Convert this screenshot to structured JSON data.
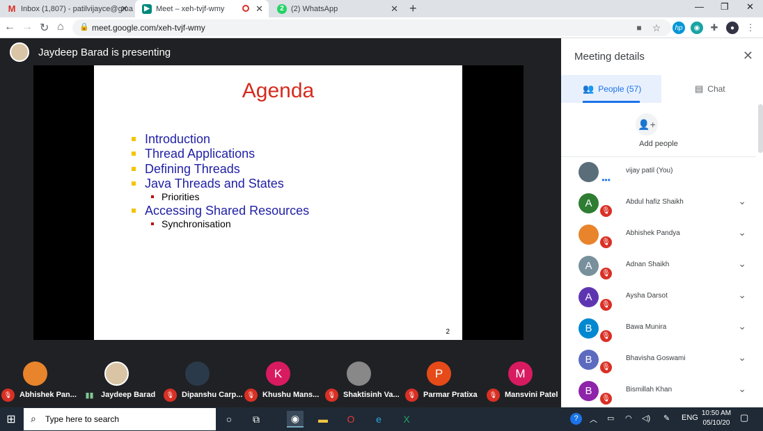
{
  "browser": {
    "tabs": [
      {
        "label": "Inbox (1,807) - patilvijayce@gma",
        "icon": "gmail-icon"
      },
      {
        "label": "Meet – xeh-tvjf-wmy",
        "icon": "meet-icon"
      },
      {
        "label": "(2) WhatsApp",
        "icon": "whatsapp-icon",
        "badge": "2"
      }
    ],
    "url": "meet.google.com/xeh-tvjf-wmy"
  },
  "stage": {
    "presenter_label": "Jaydeep Barad is presenting"
  },
  "slide": {
    "title": "Agenda",
    "bullets": [
      "Introduction",
      "Thread Applications",
      "Defining Threads",
      "Java Threads and States",
      "Accessing Shared Resources"
    ],
    "subs": [
      "Priorities",
      "Synchronisation"
    ],
    "page": "2"
  },
  "tiles": [
    {
      "name": "Abhishek Pan...",
      "avatar": "",
      "color": "#e8842c",
      "muted": true
    },
    {
      "name": "Jaydeep Barad",
      "avatar": "",
      "color": "#d9c4a5",
      "muted": false
    },
    {
      "name": "Dipanshu Carp...",
      "avatar": "",
      "color": "#2a3a4a",
      "muted": true
    },
    {
      "name": "Khushu Mans...",
      "avatar": "K",
      "color": "#d81b60",
      "muted": true
    },
    {
      "name": "Shaktisinh Va...",
      "avatar": "",
      "color": "#888888",
      "muted": true
    },
    {
      "name": "Parmar Pratixa",
      "avatar": "P",
      "color": "#e64a19",
      "muted": true
    },
    {
      "name": "Mansvini Patel",
      "avatar": "M",
      "color": "#d81b60",
      "muted": true
    }
  ],
  "panel": {
    "title": "Meeting details",
    "tab_people": "People (57)",
    "tab_chat": "Chat",
    "add_people": "Add people",
    "people": [
      {
        "name": "vijay patil (You)",
        "avatar": "",
        "color": "#5a6e7a",
        "muted": false
      },
      {
        "name": "Abdul hafiz Shaikh",
        "avatar": "A",
        "color": "#2e7d32",
        "muted": true
      },
      {
        "name": "Abhishek Pandya",
        "avatar": "",
        "color": "#e8842c",
        "muted": true
      },
      {
        "name": "Adnan Shaikh",
        "avatar": "A",
        "color": "#78909c",
        "muted": true
      },
      {
        "name": "Aysha Darsot",
        "avatar": "A",
        "color": "#5e35b1",
        "muted": true
      },
      {
        "name": "Bawa Munira",
        "avatar": "B",
        "color": "#0288d1",
        "muted": true
      },
      {
        "name": "Bhavisha Goswami",
        "avatar": "B",
        "color": "#5c6bc0",
        "muted": true
      },
      {
        "name": "Bismillah Khan",
        "avatar": "B",
        "color": "#8e24aa",
        "muted": true
      }
    ]
  },
  "taskbar": {
    "search_placeholder": "Type here to search",
    "lang": "ENG",
    "time": "10:50 AM",
    "date": "05/10/20"
  }
}
